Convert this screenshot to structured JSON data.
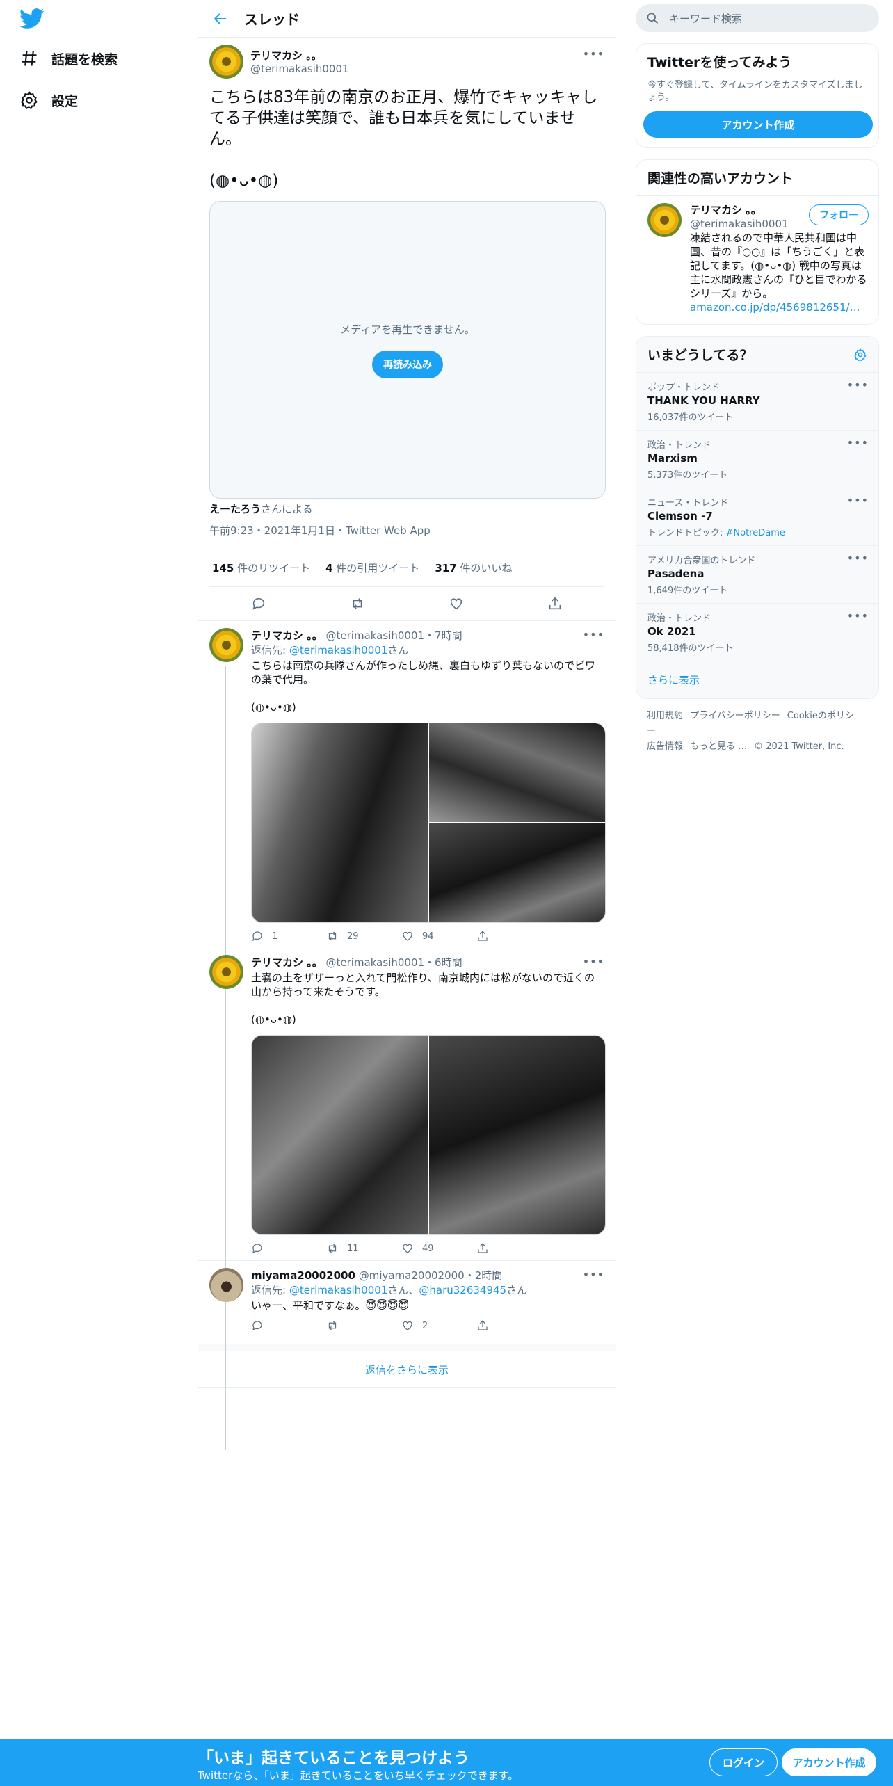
{
  "nav": {
    "explore_label": "話題を検索",
    "settings_label": "設定"
  },
  "header": {
    "title": "スレッド"
  },
  "focal": {
    "name": "テリマカシ 。。",
    "handle": "@terimakasih0001",
    "text": "こちらは83年前の南京のお正月、爆竹でキャッキャしてる子供達は笑顔で、誰も日本兵を気にしていません。\n\n(◍•ᴗ•◍)",
    "media_message": "メディアを再生できません。",
    "reload_label": "再読み込み",
    "credit_name": "えーたろう",
    "credit_suffix": "さんによる",
    "meta": "午前9:23・2021年1月1日・Twitter Web App",
    "retweets_n": "145",
    "retweets_label": " 件のリツイート",
    "quotes_n": "4",
    "quotes_label": " 件の引用ツイート",
    "likes_n": "317",
    "likes_label": " 件のいいね"
  },
  "replies": [
    {
      "name": "テリマカシ 。。",
      "handle": "@terimakasih0001",
      "time": "・7時間",
      "reply_prefix": "返信先: ",
      "reply_to": "@terimakasih0001",
      "reply_suffix": "さん",
      "text": "こちらは南京の兵隊さんが作ったしめ縄、裏白もゆずり葉もないのでビワの葉で代用。\n\n(◍•ᴗ•◍)",
      "replies": "1",
      "retweets": "29",
      "likes": "94"
    },
    {
      "name": "テリマカシ 。。",
      "handle": "@terimakasih0001",
      "time": "・6時間",
      "text": "土嚢の土をザザーっと入れて門松作り、南京城内には松がないので近くの山から持って来たそうです。\n\n(◍•ᴗ•◍)",
      "replies": "",
      "retweets": "11",
      "likes": "49"
    },
    {
      "name": "miyama20002000",
      "handle": "@miyama20002000",
      "time": "・2時間",
      "reply_prefix": "返信先: ",
      "reply_to": "@terimakasih0001",
      "reply_mid": "さん、",
      "reply_to2": "@haru32634945",
      "reply_suffix": "さん",
      "text": "いゃー、平和ですなぁ。😇😇😇😇",
      "replies": "",
      "retweets": "",
      "likes": "2"
    }
  ],
  "show_more_replies": "返信をさらに表示",
  "sidebar": {
    "search_placeholder": "キーワード検索",
    "signup_title": "Twitterを使ってみよう",
    "signup_desc": "今すぐ登録して、タイムラインをカスタマイズしましょう。",
    "signup_button": "アカウント作成",
    "related_title": "関連性の高いアカウント",
    "related_name": "テリマカシ 。。",
    "related_handle": "@terimakasih0001",
    "follow_label": "フォロー",
    "related_bio": "凍結されるので中華人民共和国は中国、昔の『○○』は「ちうごく」と表記してます。(◍•ᴗ•◍) 戦中の写真は主に水間政憲さんの『ひと目でわかるシリーズ』から。",
    "related_link": "amazon.co.jp/dp/4569812651/…",
    "trends_title": "いまどうしてる？",
    "trends": [
      {
        "context": "ポップ・トレンド",
        "name": "THANK YOU HARRY",
        "count": "16,037件のツイート"
      },
      {
        "context": "政治・トレンド",
        "name": "Marxism",
        "count": "5,373件のツイート"
      },
      {
        "context": "ニュース・トレンド",
        "name": "Clemson -7",
        "count_prefix": "トレンドトピック: ",
        "count_link": "#NotreDame"
      },
      {
        "context": "アメリカ合衆国のトレンド",
        "name": "Pasadena",
        "count": "1,649件のツイート"
      },
      {
        "context": "政治・トレンド",
        "name": "Ok 2021",
        "count": "58,418件のツイート"
      }
    ],
    "trends_more": "さらに表示",
    "footer": [
      "利用規約",
      "プライバシーポリシー",
      "Cookieのポリシー",
      "広告情報",
      "もっと見る …",
      "© 2021 Twitter, Inc."
    ]
  },
  "bottom_bar": {
    "headline": "「いま」起きていることを見つけよう",
    "sub": "Twitterなら、「いま」起きていることをいち早くチェックできます。",
    "login_label": "ログイン",
    "signup_label": "アカウント作成"
  }
}
